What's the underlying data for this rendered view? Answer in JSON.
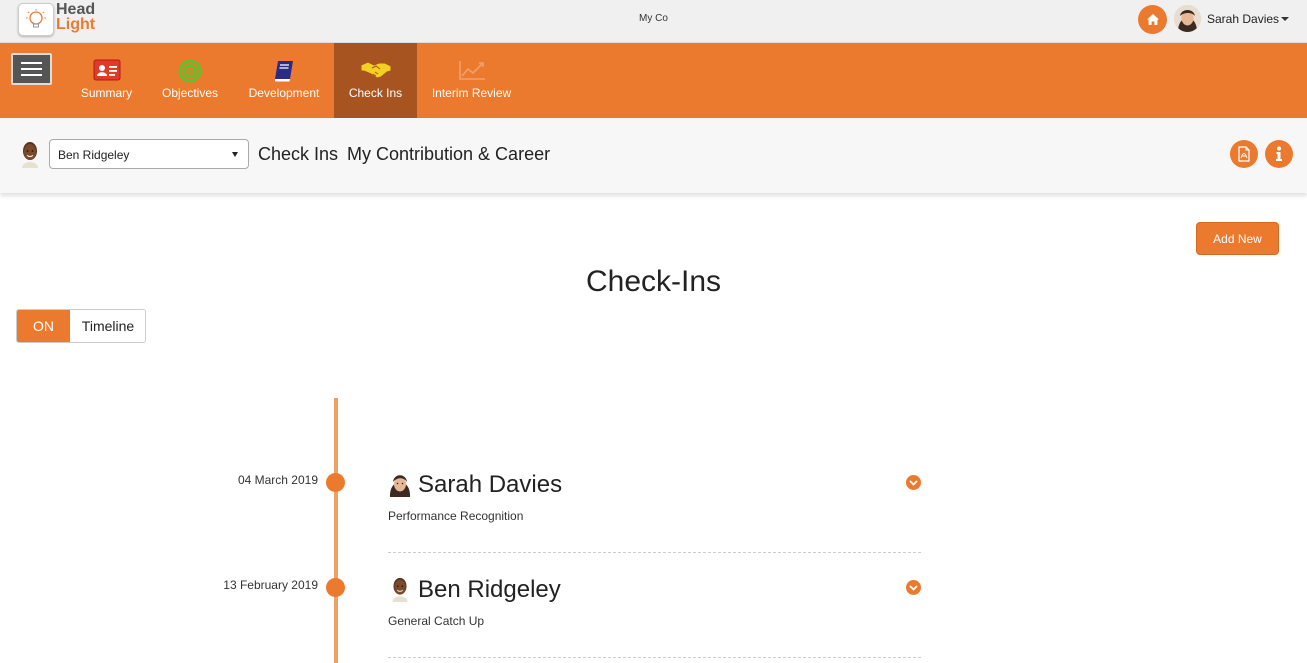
{
  "app": {
    "logo_line1": "Head",
    "logo_line2": "Light",
    "company": "My Co",
    "user_name": "Sarah Davies"
  },
  "colors": {
    "accent": "#ec7a2e",
    "nav_active": "#a85420"
  },
  "nav": {
    "items": [
      {
        "label": "Summary",
        "icon": "id-card-icon"
      },
      {
        "label": "Objectives",
        "icon": "target-icon"
      },
      {
        "label": "Development",
        "icon": "book-icon"
      },
      {
        "label": "Check Ins",
        "icon": "handshake-icon",
        "active": true
      },
      {
        "label": "Interim Review",
        "icon": "chart-line-icon"
      }
    ]
  },
  "subheader": {
    "selected_employee": "Ben Ridgeley",
    "title": "Check Ins",
    "subtitle": "My Contribution & Career"
  },
  "main": {
    "add_new_label": "Add New",
    "page_title": "Check-Ins",
    "toggle_on": "ON",
    "toggle_off": "Timeline",
    "entries": [
      {
        "date": "04 March 2019",
        "name": "Sarah Davies",
        "type": "Performance Recognition"
      },
      {
        "date": "13 February 2019",
        "name": "Ben Ridgeley",
        "type": "General Catch Up"
      }
    ]
  }
}
